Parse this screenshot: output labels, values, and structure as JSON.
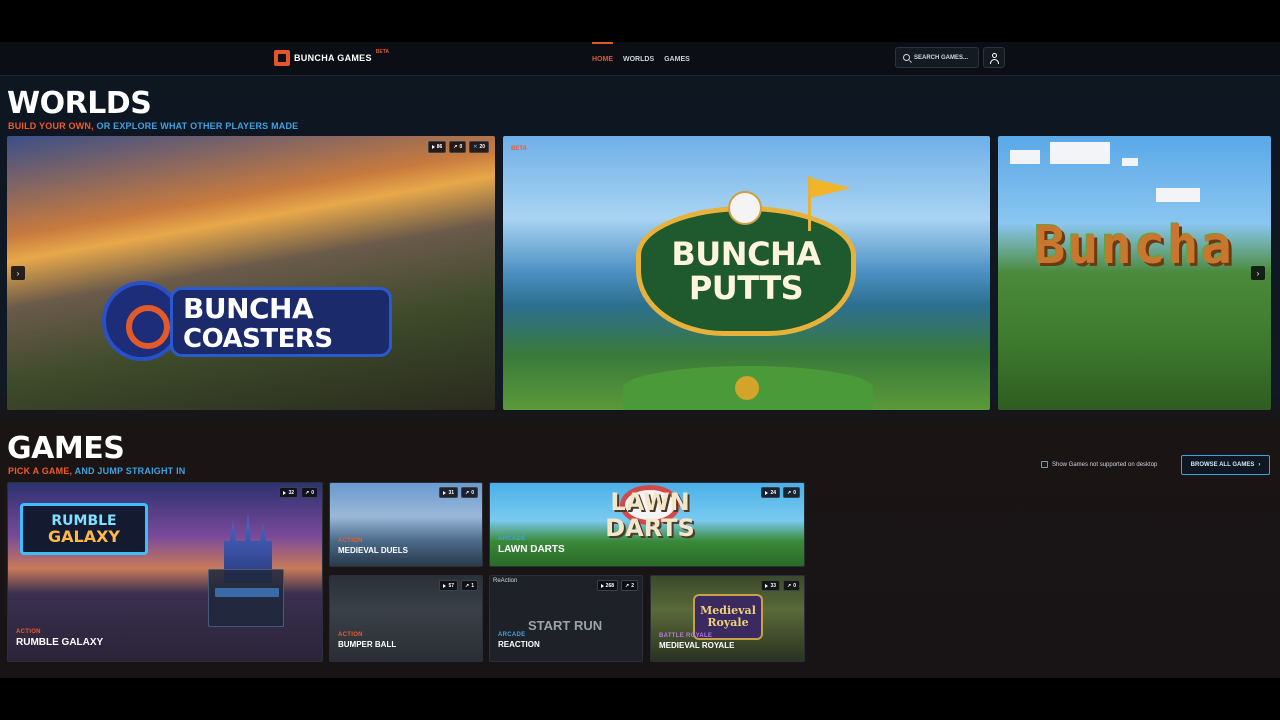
{
  "header": {
    "brand": "BUNCHA GAMES",
    "beta": "BETA",
    "nav": [
      {
        "label": "HOME",
        "active": true
      },
      {
        "label": "WORLDS",
        "active": false
      },
      {
        "label": "GAMES",
        "active": false
      }
    ],
    "search_placeholder": "SEARCH GAMES..."
  },
  "worlds": {
    "title": "WORLDS",
    "subtitle_a": "BUILD YOUR OWN,",
    "subtitle_b": "OR EXPLORE WHAT OTHER PLAYERS MADE",
    "cards": [
      {
        "logo_line1": "BUNCHA",
        "logo_line2": "COASTERS",
        "stats": [
          "86",
          "0",
          "20"
        ]
      },
      {
        "tag": "BETA",
        "logo_line1": "BUNCHA",
        "logo_line2": "PUTTS"
      },
      {
        "logo": "Buncha"
      }
    ],
    "prev_arrow": "›",
    "next_arrow": "›"
  },
  "games": {
    "title": "GAMES",
    "subtitle_a": "PICK A GAME,",
    "subtitle_b": "AND JUMP STRAIGHT IN",
    "show_unsupported_label": "Show Games not supported on desktop",
    "browse_label": "BROWSE ALL GAMES",
    "cards": [
      {
        "category": "ACTION",
        "name": "RUMBLE GALAXY",
        "stats": [
          "32",
          "0"
        ],
        "logo_line1": "RUMBLE",
        "logo_line2": "GALAXY"
      },
      {
        "category": "ACTION",
        "name": "MEDIEVAL DUELS",
        "stats": [
          "31",
          "0"
        ]
      },
      {
        "category": "ARCADE",
        "name": "LAWN DARTS",
        "stats": [
          "24",
          "0"
        ],
        "logo_line1": "LAWN",
        "logo_line2": "DARTS"
      },
      {
        "category": "ACTION",
        "name": "BUMPER BALL",
        "stats": [
          "57",
          "1"
        ]
      },
      {
        "category": "ARCADE",
        "name": "REACTION",
        "stats": [
          "268",
          "2"
        ],
        "overlay_title": "ReAction",
        "overlay_text": "START RUN"
      },
      {
        "category": "BATTLE ROYALE",
        "name": "MEDIEVAL ROYALE",
        "stats": [
          "33",
          "0"
        ],
        "logo_line1": "Medieval",
        "logo_line2": "Royale"
      }
    ]
  }
}
